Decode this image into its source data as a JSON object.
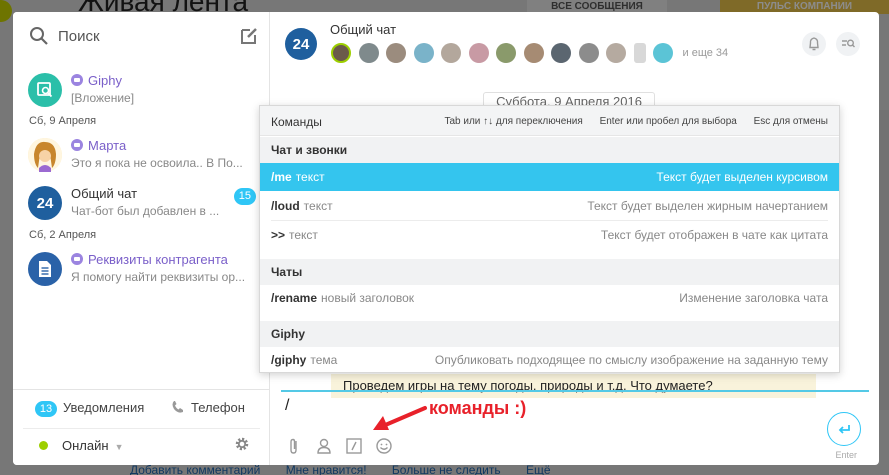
{
  "background": {
    "page_title": "Живая лента",
    "tab_all_messages": "ВСЕ СООБЩЕНИЯ",
    "tab_company_pulse": "ПУЛЬС КОМПАНИИ",
    "bottom_links": [
      "Добавить комментарий",
      "Мне нравится!",
      "Больше не следить",
      "Ещё"
    ]
  },
  "sidebar": {
    "search_placeholder": "Поиск",
    "chats": [
      {
        "name": "Giphy",
        "preview": "[Вложение]",
        "bot": true,
        "avatar_color": "#2bbfa9"
      },
      {
        "name": "Марта",
        "preview": "Это я пока не освоила.. В По...",
        "bot": true,
        "avatar_color": "#f2b64c"
      },
      {
        "name": "Общий чат",
        "preview": "Чат-бот был добавлен в ...",
        "bot": false,
        "avatar_text": "24",
        "avatar_color": "#1f5f9e",
        "unread": "15"
      },
      {
        "name": "Реквизиты контрагента",
        "preview": "Я помогу найти реквизиты ор...",
        "bot": true,
        "avatar_color": "#2a62a8"
      }
    ],
    "date_separators": [
      "Сб, 9 Апреля",
      "Сб, 2 Апреля"
    ],
    "footer": {
      "notifications_count": "13",
      "notifications_label": "Уведомления",
      "phone_label": "Телефон",
      "status_label": "Онлайн"
    }
  },
  "chat": {
    "avatar_text": "24",
    "title": "Общий чат",
    "more_members": "и еще 34",
    "date_pill": "Суббота, 9 Апреля 2016",
    "message_text": "Проведем игры на тему погоды, природы и т.д. Что думаете?",
    "input_value": "/",
    "annotation": "команды :)",
    "send_label": "Enter"
  },
  "popup": {
    "title": "Команды",
    "hints": [
      "Tab или ↑↓ для переключения",
      "Enter или пробел для выбора",
      "Esc для отмены"
    ],
    "groups": [
      {
        "name": "Чат и звонки",
        "commands": [
          {
            "name": "/me",
            "param": "текст",
            "desc": "Текст будет выделен курсивом",
            "selected": true
          },
          {
            "name": "/loud",
            "param": "текст",
            "desc": "Текст будет выделен жирным начертанием"
          },
          {
            "name": ">>",
            "param": "текст",
            "desc": "Текст будет отображен в чате как цитата"
          }
        ]
      },
      {
        "name": "Чаты",
        "commands": [
          {
            "name": "/rename",
            "param": "новый заголовок",
            "desc": "Изменение заголовка чата"
          }
        ]
      },
      {
        "name": "Giphy",
        "commands": [
          {
            "name": "/giphy",
            "param": "тема",
            "desc": "Опубликовать подходящее по смыслу изображение на заданную тему"
          }
        ]
      }
    ]
  }
}
